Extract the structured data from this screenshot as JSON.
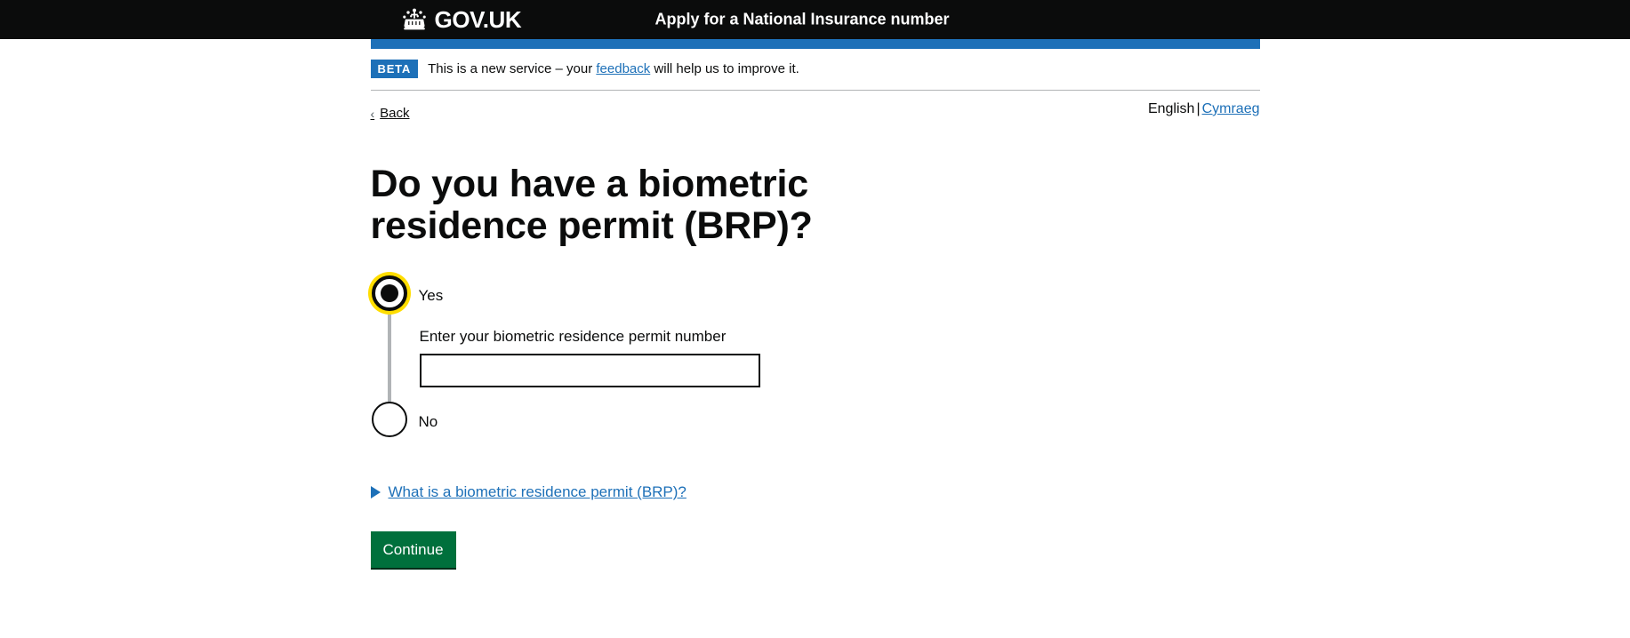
{
  "header": {
    "logo_text": "GOV.UK",
    "crown_icon": "crown-icon",
    "service_name": "Apply for a National Insurance number"
  },
  "phase_banner": {
    "tag": "BETA",
    "text_before": "This is a new service – your ",
    "link_text": "feedback",
    "text_after": " will help us to improve it."
  },
  "navigation": {
    "back_label": "Back",
    "back_chevron": "chevron-left-icon",
    "language": {
      "current": "English",
      "separator": "|",
      "alternative": "Cymraeg"
    }
  },
  "main": {
    "heading": "Do you have a biometric residence permit (BRP)?",
    "radios": [
      {
        "label": "Yes",
        "checked": true,
        "focused": true
      },
      {
        "label": "No",
        "checked": false,
        "focused": false
      }
    ],
    "conditional": {
      "field_label": "Enter your biometric residence permit number",
      "input_value": "",
      "input_placeholder": ""
    },
    "details": {
      "summary": "What is a biometric residence permit (BRP)?",
      "arrow_icon": "triangle-right-icon",
      "expanded": false
    },
    "continue_label": "Continue"
  },
  "colors": {
    "header_black": "#0b0c0c",
    "govuk_blue": "#1d70b8",
    "button_green": "#00703c",
    "focus_yellow": "#ffdd00",
    "border_grey": "#b1b4b6"
  }
}
